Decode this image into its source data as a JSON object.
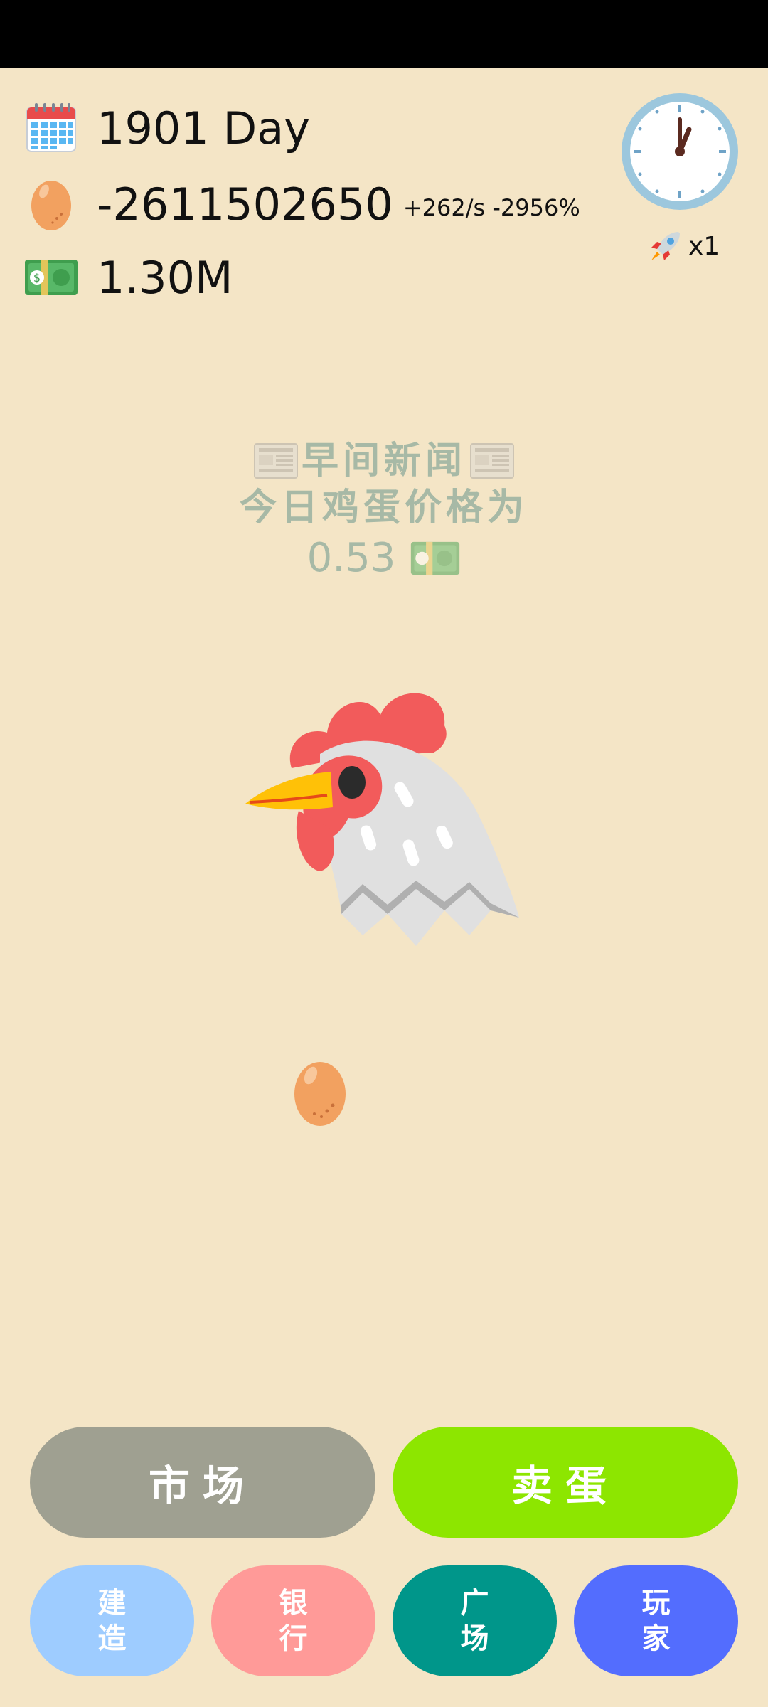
{
  "stats": {
    "day": "1901 Day",
    "eggs": "-2611502650",
    "egg_rate": "+262/s -2956%",
    "money": "1.30M"
  },
  "speed": {
    "multiplier": "x1"
  },
  "news": {
    "headline": "早间新闻",
    "line": "今日鸡蛋价格为",
    "price": "0.53"
  },
  "buttons": {
    "market": "市场",
    "sell_eggs": "卖蛋",
    "build": "建造",
    "bank": "银行",
    "plaza": "广场",
    "player": "玩家"
  },
  "colors": {
    "background": "#F4E5C6",
    "market_button": "#9FA091",
    "sell_button": "#8DE600",
    "build_button": "#9ECCFF",
    "bank_button": "#FF9A98",
    "plaza_button": "#00968A",
    "player_button": "#536DFE",
    "news_text": "#A7B9A6"
  },
  "icons": {
    "day": "calendar-icon",
    "eggs": "egg-icon",
    "money": "dollar-banknote-icon",
    "clock": "clock-icon",
    "speed": "rocket-icon",
    "news": "newspaper-icon",
    "price": "dollar-banknote-icon",
    "character": "rooster-icon"
  }
}
